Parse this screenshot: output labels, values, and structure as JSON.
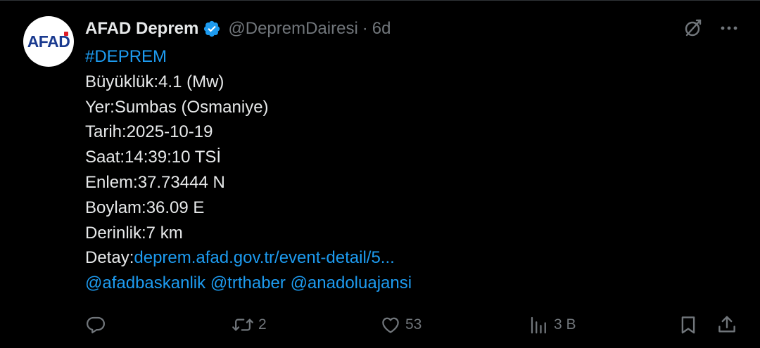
{
  "account": {
    "avatar_text": "AFAD",
    "name": "AFAD Deprem",
    "handle": "@DepremDairesi",
    "separator": "·",
    "time": "6d"
  },
  "tweet": {
    "hashtag": "#DEPREM",
    "lines": [
      "Büyüklük:4.1 (Mw)",
      "Yer:Sumbas (Osmaniye)",
      "Tarih:2025-10-19",
      "Saat:14:39:10 TSİ",
      "Enlem:37.73444 N",
      "Boylam:36.09 E",
      "Derinlik:7 km"
    ],
    "detail_label": "Detay:",
    "detail_link": "deprem.afad.gov.tr/event-detail/5...",
    "mentions": [
      "@afadbaskanlik",
      "@trthaber",
      "@anadoluajansi"
    ]
  },
  "stats": {
    "replies": "",
    "reposts": "2",
    "likes": "53",
    "views": "3 B"
  },
  "icons": {
    "verified": "verified-badge-icon",
    "grok": "grok-icon",
    "more": "more-icon",
    "reply": "reply-icon",
    "repost": "repost-icon",
    "like": "heart-icon",
    "views": "views-icon",
    "bookmark": "bookmark-icon",
    "share": "share-icon"
  },
  "colors": {
    "background": "#000000",
    "text": "#e7e9ea",
    "muted": "#71767b",
    "link": "#1d9bf0",
    "verified": "#1d9bf0",
    "afad_blue": "#1a3a8f",
    "afad_red": "#e11d26"
  }
}
